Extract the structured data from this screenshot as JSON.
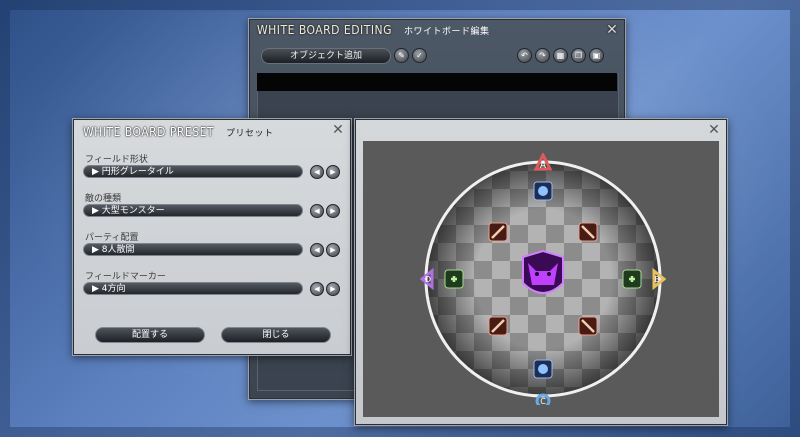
{
  "editing": {
    "title_en": "WHITE BOARD EDITING",
    "title_jp": "ホワイトボード編集",
    "add_object_label": "オブジェクト追加"
  },
  "preset": {
    "title_en": "WHITE BOARD PRESET",
    "title_jp": "プリセット",
    "fields": [
      {
        "label": "フィールド形状",
        "value": "円形グレータイル"
      },
      {
        "label": "敵の種類",
        "value": "大型モンスター"
      },
      {
        "label": "パーティ配置",
        "value": "8人散開"
      },
      {
        "label": "フィールドマーカー",
        "value": "4方向"
      }
    ],
    "place_button": "配置する",
    "close_button": "閉じる"
  },
  "field": {
    "markers": {
      "top": "A",
      "right": "B",
      "bottom": "C",
      "left": "D"
    },
    "colors": {
      "A": "#e05a5a",
      "B": "#e8c060",
      "C": "#6aa8e8",
      "D": "#b070e0"
    }
  }
}
